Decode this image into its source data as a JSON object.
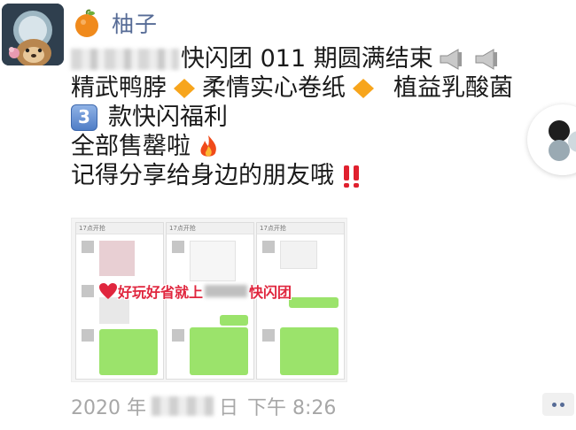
{
  "author": {
    "name": "柚子",
    "avatar_icon": "raccoon-avatar-icon"
  },
  "post": {
    "line1_text": "快闪团 011 期圆满结束",
    "products": [
      "精武鸭脖",
      "柔情实心卷纸",
      "植益乳酸菌"
    ],
    "line3_keycap": "3",
    "line3_text": "款快闪福利",
    "line4_text": "全部售罄啦",
    "line5_text": "记得分享给身边的朋友哦",
    "icons": [
      "megaphone-icon",
      "diamond-icon",
      "keycap-icon",
      "fire-icon",
      "double-exclamation-icon"
    ]
  },
  "image": {
    "banner_prefix": "好玩好省就上",
    "banner_suffix": "快闪团",
    "phone_titles": [
      "17点开抢",
      "17点开抢",
      "17点开抢"
    ]
  },
  "meta": {
    "year": "2020 年",
    "day_suffix": "日",
    "time": "下午 8:26"
  },
  "colors": {
    "name": "#566b96",
    "accent_red": "#e0263e",
    "bubble_green": "#9be36b",
    "time_gray": "#a7a7a7"
  }
}
